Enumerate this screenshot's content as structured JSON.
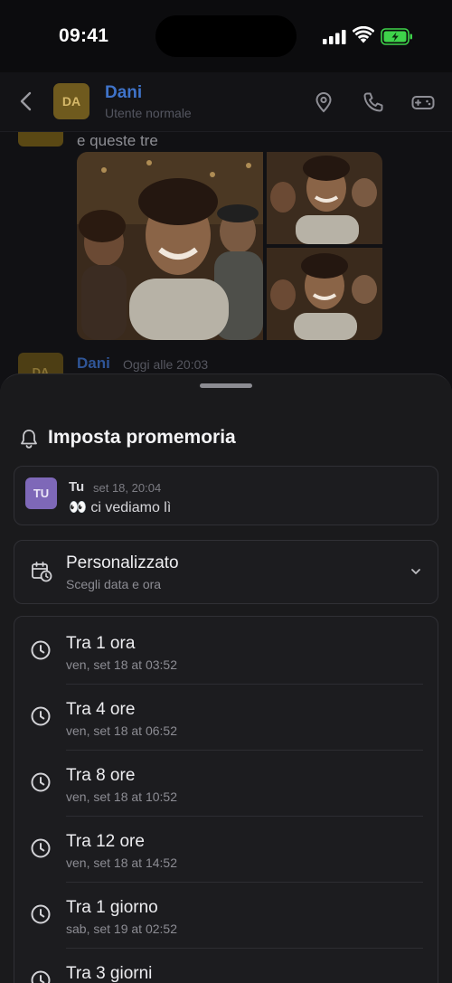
{
  "status_bar": {
    "time": "09:41"
  },
  "header": {
    "avatar_initials": "DA",
    "name": "Dani",
    "subtitle": "Utente normale"
  },
  "chat": {
    "previous_message": "e queste tre",
    "next_message": {
      "avatar_initials": "DA",
      "author": "Dani",
      "time": "Oggi alle 20:03"
    }
  },
  "sheet": {
    "title": "Imposta promemoria",
    "quoted": {
      "avatar_initials": "TU",
      "author": "Tu",
      "time": "set 18, 20:04",
      "text": "👀 ci vediamo lì"
    },
    "custom": {
      "title": "Personalizzato",
      "subtitle": "Scegli data e ora"
    },
    "options": [
      {
        "label": "Tra 1 ora",
        "when": "ven, set 18 at 03:52"
      },
      {
        "label": "Tra 4 ore",
        "when": "ven, set 18 at 06:52"
      },
      {
        "label": "Tra 8 ore",
        "when": "ven, set 18 at 10:52"
      },
      {
        "label": "Tra 12 ore",
        "when": "ven, set 18 at 14:52"
      },
      {
        "label": "Tra 1 giorno",
        "when": "sab, set 19 at 02:52"
      },
      {
        "label": "Tra 3 giorni",
        "when": ""
      }
    ]
  },
  "colors": {
    "accent_name": "#3f73c9",
    "battery": "#3ed34a",
    "self_avatar": "#7e68b8",
    "dani_avatar": "#6f5a1e"
  },
  "icons": [
    "signal-icon",
    "wifi-icon",
    "battery-icon",
    "back-icon",
    "location-icon",
    "phone-icon",
    "gamepad-icon",
    "bell-icon",
    "calendar-clock-icon",
    "chevron-down-icon",
    "clock-icon"
  ]
}
